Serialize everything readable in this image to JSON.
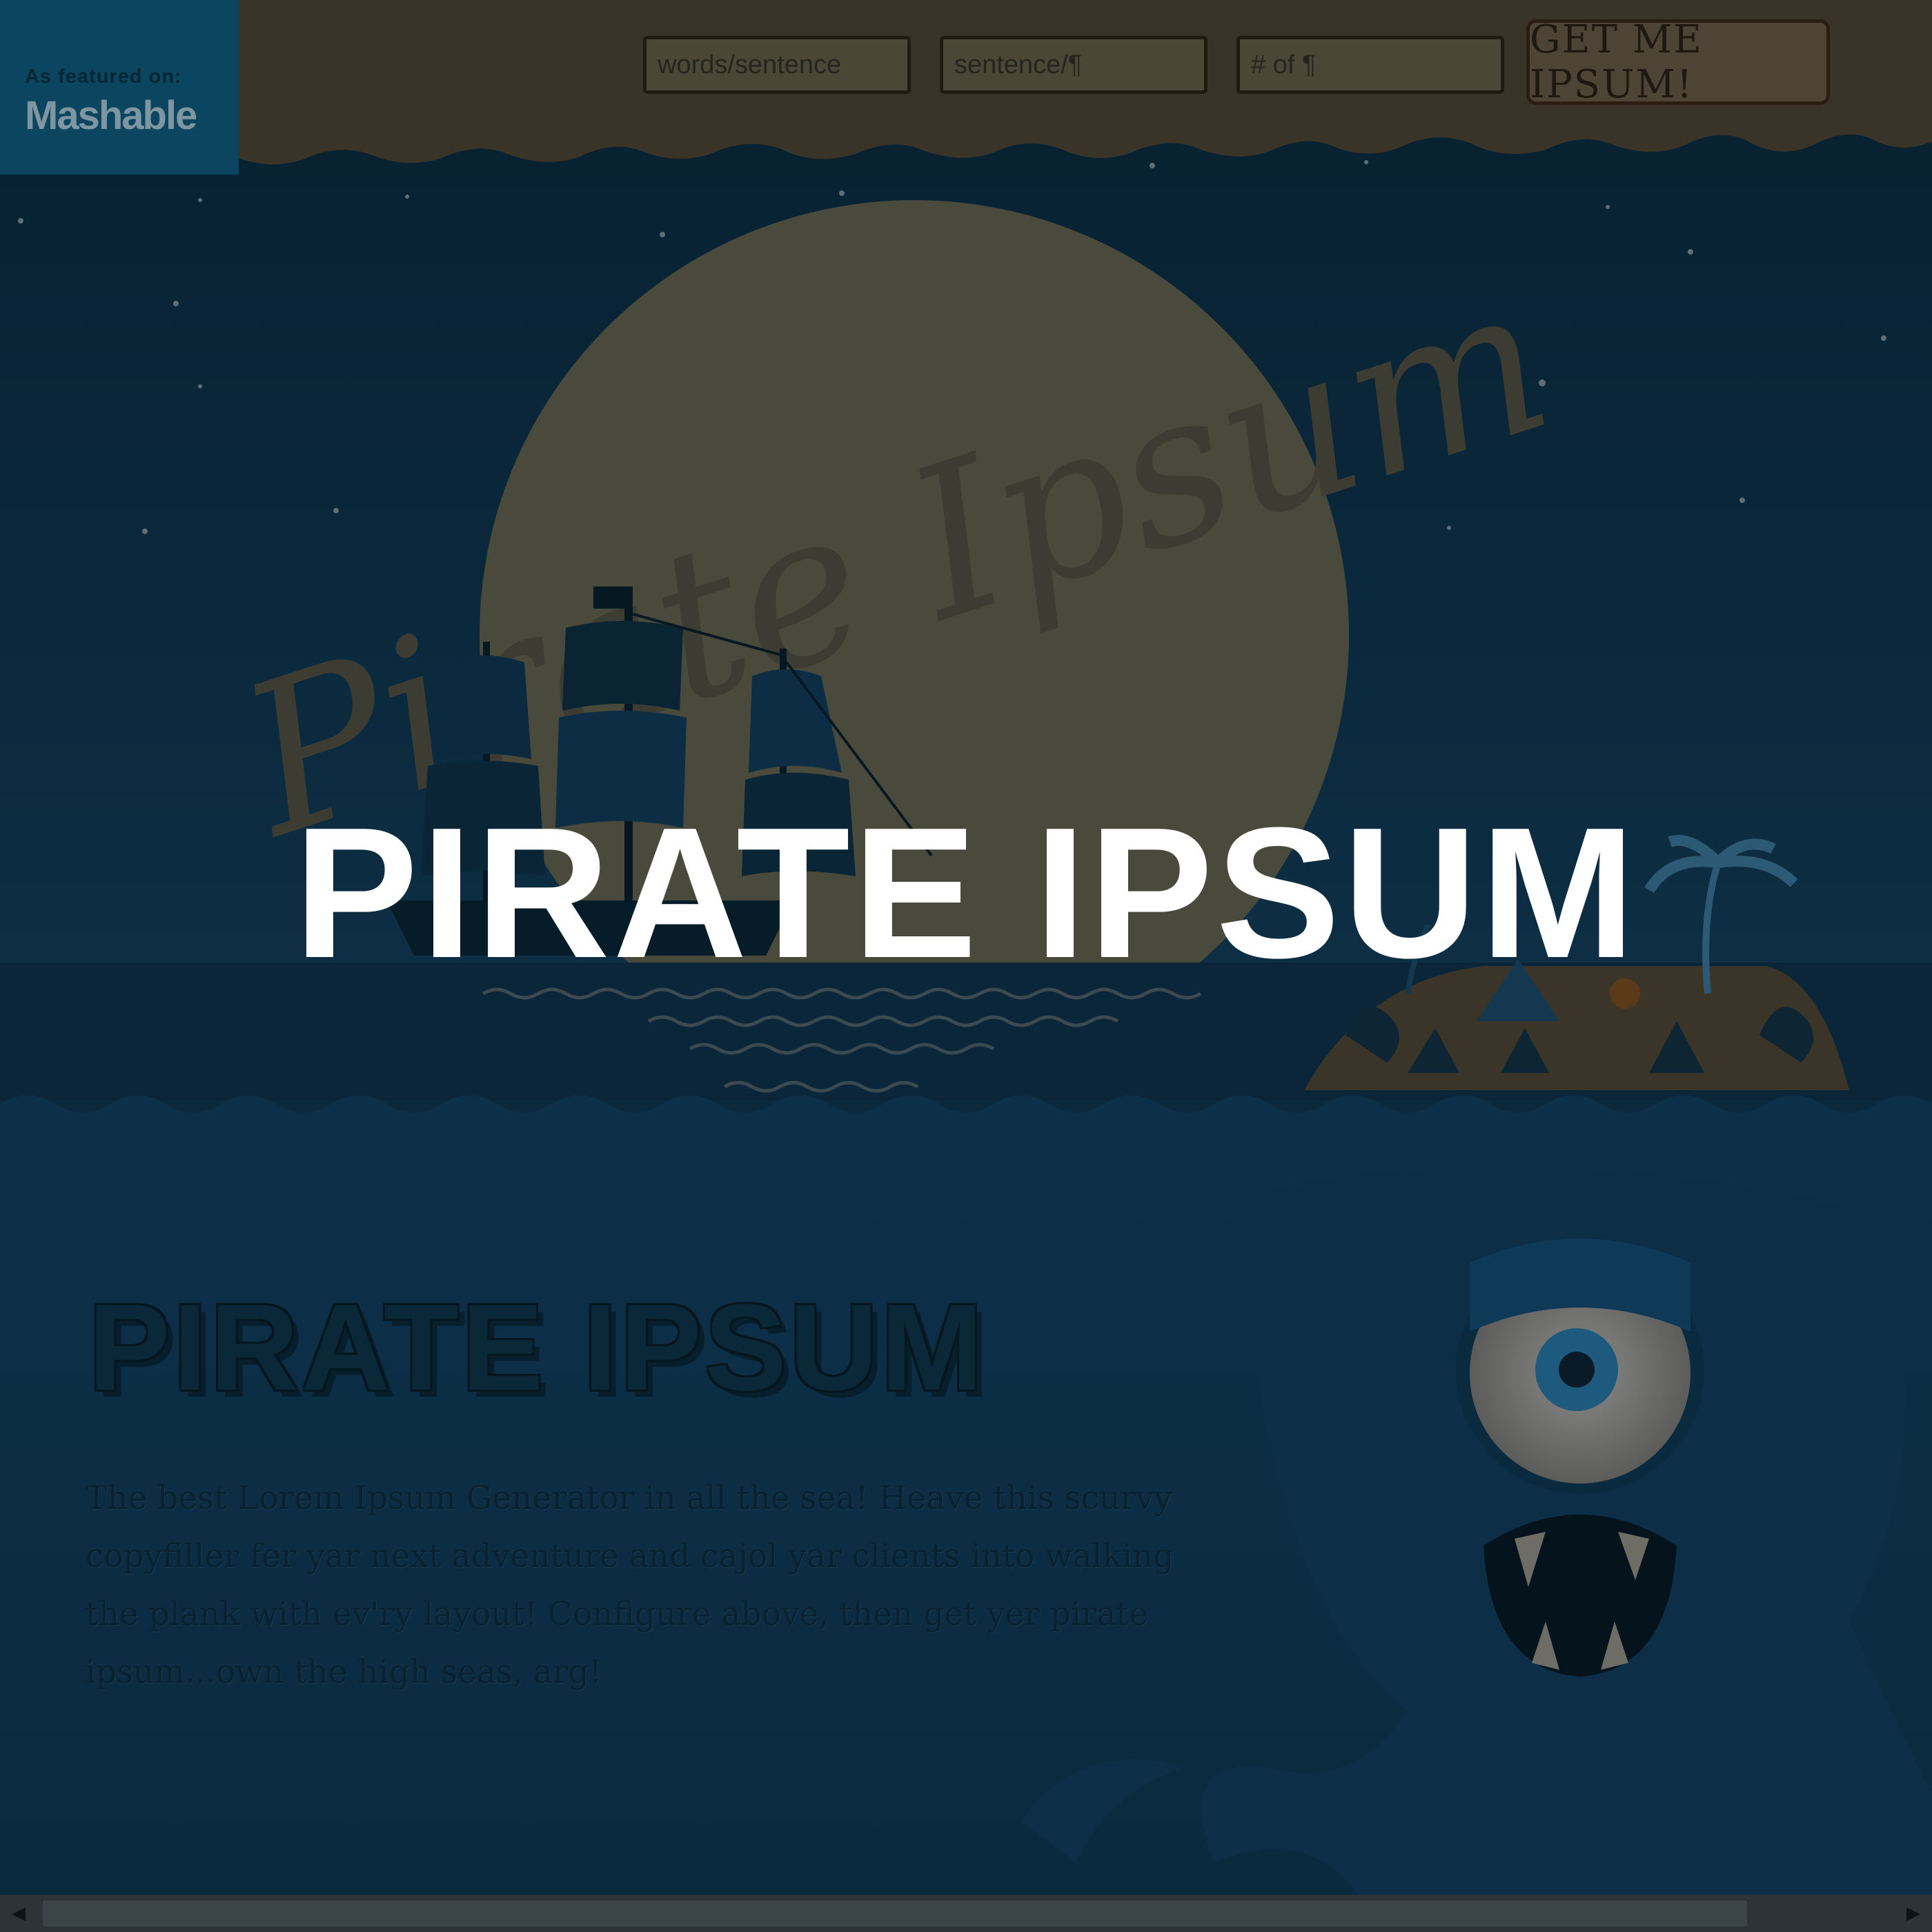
{
  "featured": {
    "small_text": "As featured on:",
    "logo_text": "Mashable"
  },
  "form": {
    "words_placeholder": "words/sentence",
    "sentence_placeholder": "sentence/¶",
    "paragraphs_placeholder": "# of ¶",
    "submit_label": "GET ME IPSUM!"
  },
  "hero": {
    "moon_logo": "Pirate Ipsum",
    "title": "PIRATE IPSUM"
  },
  "about": {
    "title": "PIRATE IPSUM",
    "description": "The best Lorem Ipsum Generator in all the sea! Heave this scurvy copyfiller fer yar next adventure and cajol yar clients into walking the plank with ev'ry layout! Configure above, then get yer pirate ipsum...own the high seas, arg!"
  },
  "scrollbar": {
    "left_arrow": "◀",
    "right_arrow": "▶"
  },
  "colors": {
    "sky": "#0c2a3e",
    "moon": "#4a4a3c",
    "sea": "#0b2f45",
    "overlay_title": "#ffffff"
  }
}
